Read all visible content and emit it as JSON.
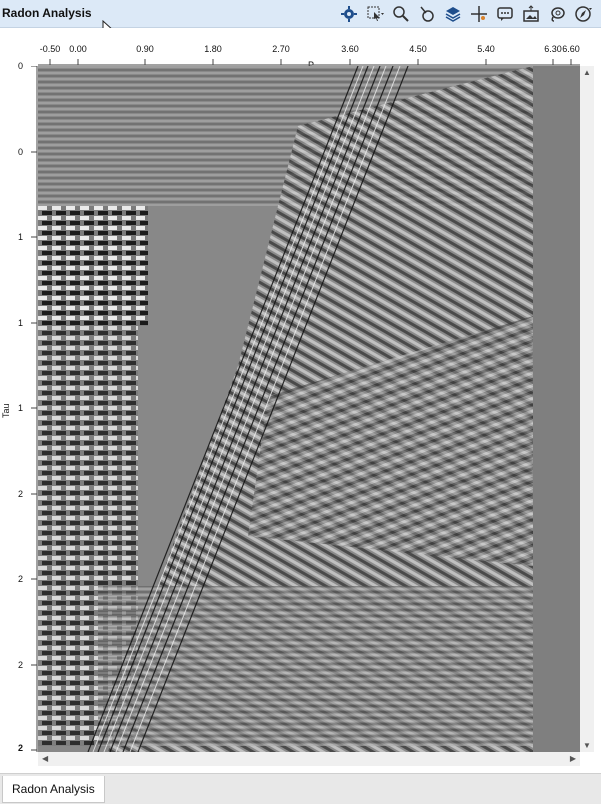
{
  "window": {
    "title": "Radon Analysis"
  },
  "toolbar": {
    "icons": [
      "gear-icon",
      "select-region-icon",
      "zoom-icon",
      "probe-icon",
      "layers-icon",
      "crosshair-icon",
      "comment-icon",
      "export-image-icon",
      "lasso-icon",
      "compass-icon"
    ]
  },
  "plot": {
    "x_axis_title": "P",
    "y_axis_title": "Tau",
    "x_ticks": [
      "-0.50",
      "0.00",
      "0.90",
      "1.80",
      "2.70",
      "3.60",
      "4.50",
      "5.40",
      "6.30",
      "6.60"
    ],
    "y_ticks": [
      "0",
      "0",
      "1",
      "1",
      "1",
      "2",
      "2",
      "2",
      "2"
    ]
  },
  "tabs": [
    {
      "label": "Radon Analysis"
    }
  ]
}
